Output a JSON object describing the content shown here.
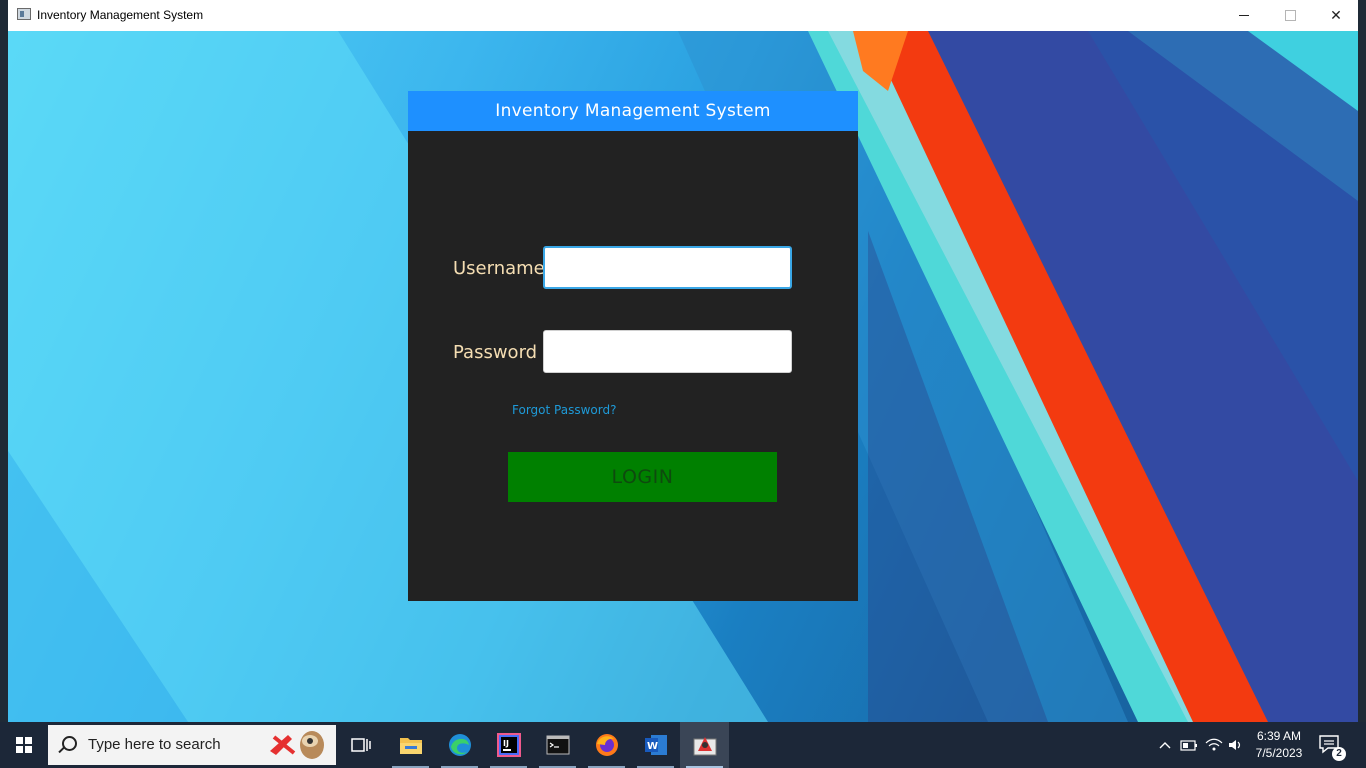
{
  "window": {
    "title": "Inventory Management System",
    "controls": {
      "minimize": "minimize",
      "maximize": "maximize",
      "close": "close"
    }
  },
  "login": {
    "header": "Inventory Management System",
    "username_label": "Username",
    "password_label": "Password",
    "username_value": "",
    "password_value": "",
    "forgot_link": "Forgot Password?",
    "login_button": "LOGIN"
  },
  "taskbar": {
    "search_placeholder": "Type here to search",
    "apps": [
      "task-view",
      "file-explorer",
      "edge",
      "intellij",
      "terminal",
      "firefox",
      "word",
      "java-app"
    ],
    "time": "6:39 AM",
    "date": "7/5/2023",
    "notification_count": "2"
  },
  "colors": {
    "header": "#1e90ff",
    "panel": "#222222",
    "label": "#f5deb3",
    "link": "#1e9ad8",
    "login_button": "#008000"
  }
}
